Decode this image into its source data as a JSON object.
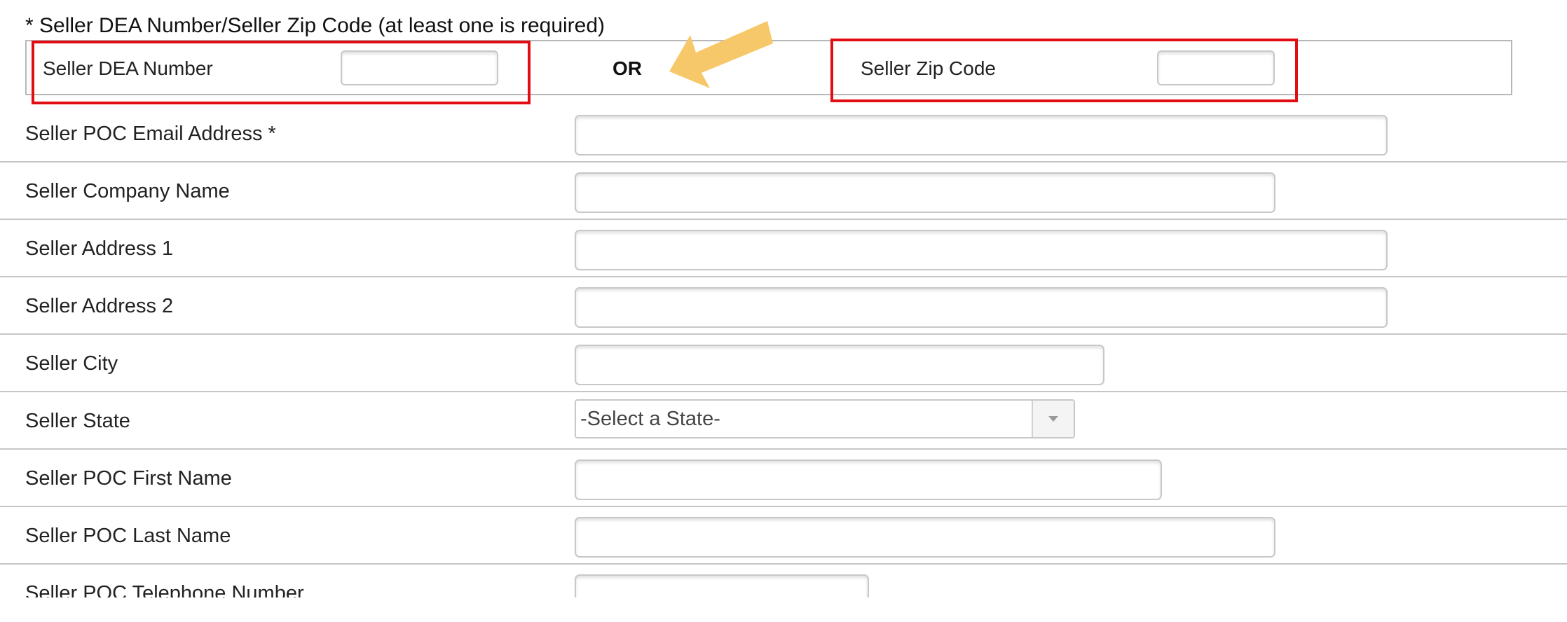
{
  "requirement": {
    "title": "* Seller DEA Number/Seller Zip Code (at least one is required)",
    "dea_label": "Seller DEA Number",
    "or_label": "OR",
    "zip_label": "Seller Zip Code"
  },
  "annotation_colors": {
    "highlight_box": "#e10d13",
    "arrow": "#f7c86a"
  },
  "form": {
    "email_label": "Seller POC Email Address  *",
    "company_label": "Seller Company Name",
    "address1_label": "Seller Address 1",
    "address2_label": "Seller Address 2",
    "city_label": "Seller City",
    "state_label": "Seller State",
    "state_selected": "-Select a State-",
    "first_name_label": "Seller POC First Name",
    "last_name_label": "Seller POC Last Name",
    "telephone_label": "Seller POC Telephone Number"
  },
  "icons": {
    "dropdown": "chevron-down-icon",
    "annotation": "arrow-icon"
  }
}
